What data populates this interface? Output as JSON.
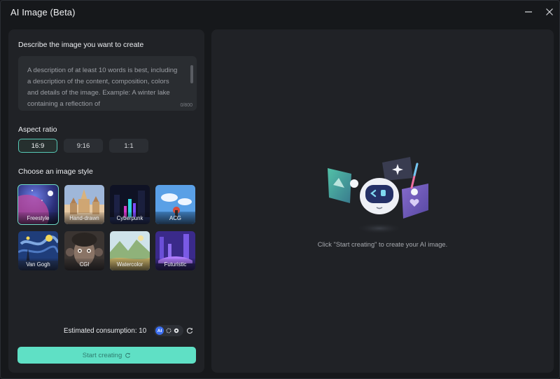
{
  "window": {
    "title": "AI Image (Beta)"
  },
  "prompt": {
    "label": "Describe the image you want to create",
    "placeholder": "A description of at least 10 words is best, including a description of the content, composition, colors and details of the image. Example: A winter lake containing a reflection of",
    "counter": "0/800"
  },
  "aspect": {
    "label": "Aspect ratio",
    "options": [
      {
        "label": "16:9",
        "selected": true
      },
      {
        "label": "9:16",
        "selected": false
      },
      {
        "label": "1:1",
        "selected": false
      }
    ]
  },
  "styles": {
    "label": "Choose an image style",
    "items": [
      {
        "label": "Freestyle",
        "selected": true
      },
      {
        "label": "Hand-drawn",
        "selected": false
      },
      {
        "label": "Cyberpunk",
        "selected": false
      },
      {
        "label": "ACG",
        "selected": false
      },
      {
        "label": "Van Gogh",
        "selected": false
      },
      {
        "label": "CGI",
        "selected": false
      },
      {
        "label": "Watercolor",
        "selected": false
      },
      {
        "label": "Futuristic",
        "selected": false
      }
    ]
  },
  "footer": {
    "consumption": "Estimated consumption: 10",
    "ai_badge": "AI",
    "start_label": "Start creating"
  },
  "preview": {
    "hint": "Click \"Start creating\" to create your AI image."
  },
  "colors": {
    "accent": "#5fe0c5",
    "panel": "#202226",
    "background": "#16181b"
  }
}
